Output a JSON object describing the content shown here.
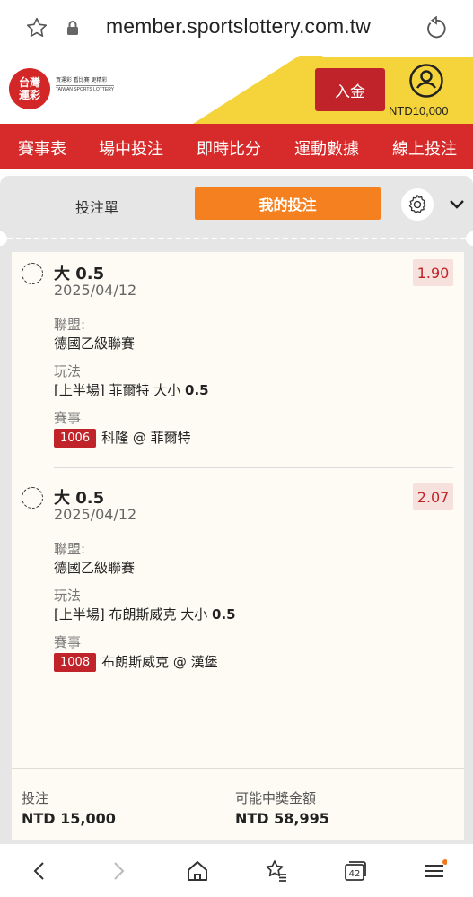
{
  "browser": {
    "url": "member.sportslottery.com.tw",
    "tabs_count": "42"
  },
  "header": {
    "logo_zh_line1": "台灣",
    "logo_zh_line2": "運彩",
    "logo_slogan": "買運彩 看比賽 更精彩",
    "logo_en": "TAIWAN SPORTS LOTTERY",
    "deposit_label": "入金",
    "balance": "NTD10,000"
  },
  "nav": {
    "items": [
      "賽事表",
      "場中投注",
      "即時比分",
      "運動數據",
      "線上投注"
    ]
  },
  "tabs": {
    "bet_slip": "投注單",
    "my_bets": "我的投注"
  },
  "labels": {
    "league": "聯盟:",
    "market": "玩法",
    "event": "賽事"
  },
  "bets": [
    {
      "title": "大 0.5",
      "date": "2025/04/12",
      "odds": "1.90",
      "league": "德國乙級聯賽",
      "market_prefix": "[上半場] 菲爾特 大小 ",
      "market_line": "0.5",
      "event_code": "1006",
      "event_name": "科隆 @ 菲爾特"
    },
    {
      "title": "大 0.5",
      "date": "2025/04/12",
      "odds": "2.07",
      "league": "德國乙級聯賽",
      "market_prefix": "[上半場] 布朗斯威克 大小 ",
      "market_line": "0.5",
      "event_code": "1008",
      "event_name": "布朗斯威克 @ 漢堡"
    }
  ],
  "totals": {
    "stake_label": "投注",
    "stake_value": "NTD 15,000",
    "payout_label": "可能中獎金額",
    "payout_value": "NTD 58,995"
  },
  "colors": {
    "brand_red": "#d72b2b",
    "accent_orange": "#f58020",
    "header_yellow": "#f5d33a",
    "badge_red": "#c0242a"
  }
}
